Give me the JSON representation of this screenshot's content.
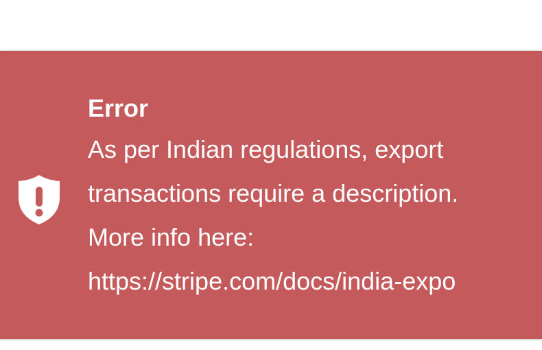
{
  "toast": {
    "icon": "shield-exclamation-icon",
    "title": "Error",
    "lines": [
      "As per Indian regulations, export",
      "transactions require a description.",
      "More info here:",
      "https://stripe.com/docs/india-expo"
    ],
    "colors": {
      "background": "#c55a5c",
      "text": "#ffffff"
    }
  }
}
